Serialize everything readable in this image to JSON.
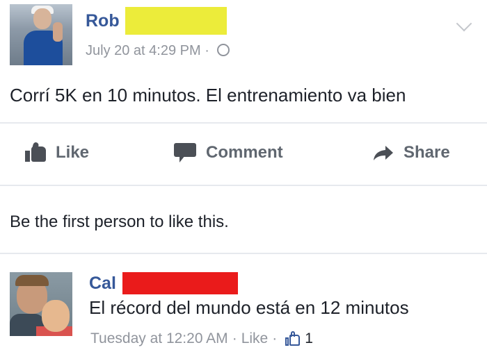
{
  "post": {
    "author": "Rob",
    "timestamp": "July 20 at 4:29 PM",
    "separator": "·",
    "privacy_icon": "globe-icon",
    "text": "Corrí 5K en 10 minutos. El entrenamiento va bien"
  },
  "actions": {
    "like": "Like",
    "comment": "Comment",
    "share": "Share"
  },
  "likes_summary": "Be the first person to like this.",
  "comment": {
    "author": "Cal",
    "text": "El récord del mundo está en 12 minutos",
    "timestamp": "Tuesday at 12:20 AM",
    "separator": "·",
    "like_label": "Like",
    "like_count": "1"
  },
  "colors": {
    "name_link": "#365899",
    "meta_gray": "#90949c",
    "redaction_yellow": "#ecec3a",
    "redaction_red": "#ea1b1b"
  }
}
